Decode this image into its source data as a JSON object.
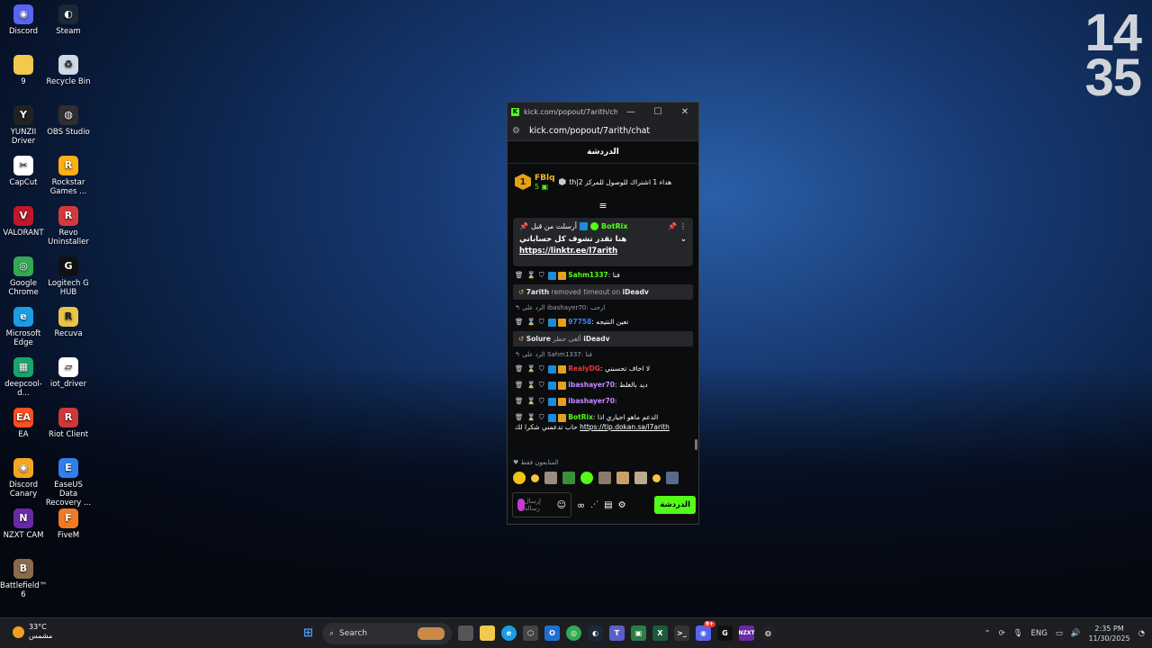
{
  "desktop": {
    "clock_hour": "14",
    "clock_minute": "35",
    "icons_col1": [
      {
        "label": "Discord",
        "icon": "discord-icon",
        "color": "#5865f2",
        "glyph": "◉"
      },
      {
        "label": "9",
        "icon": "folder-icon",
        "color": "#f2c94c",
        "glyph": ""
      },
      {
        "label": "YUNZII Driver",
        "icon": "yunzii-icon",
        "color": "#222222",
        "glyph": "Y"
      },
      {
        "label": "CapCut",
        "icon": "capcut-icon",
        "color": "#ffffff",
        "glyph": "✂"
      },
      {
        "label": "VALORANT",
        "icon": "valorant-icon",
        "color": "#c0172b",
        "glyph": "V"
      },
      {
        "label": "Google Chrome",
        "icon": "chrome-icon",
        "color": "#34a853",
        "glyph": "◎"
      },
      {
        "label": "Microsoft Edge",
        "icon": "edge-icon",
        "color": "#1b9de2",
        "glyph": "e"
      },
      {
        "label": "deepcool-d...",
        "icon": "deepcool-icon",
        "color": "#1aa56b",
        "glyph": "▦"
      },
      {
        "label": "EA",
        "icon": "ea-icon",
        "color": "#ff4f1e",
        "glyph": "EA"
      },
      {
        "label": "Discord Canary",
        "icon": "discord-canary-icon",
        "color": "#f5a623",
        "glyph": "◉"
      },
      {
        "label": "NZXT CAM",
        "icon": "nzxt-icon",
        "color": "#6a2aa8",
        "glyph": "N"
      },
      {
        "label": "Battlefield™ 6",
        "icon": "battlefield-icon",
        "color": "#8b6a4a",
        "glyph": "B"
      }
    ],
    "icons_col2": [
      {
        "label": "Steam",
        "icon": "steam-icon",
        "color": "#1b2838",
        "glyph": "◐"
      },
      {
        "label": "Recycle Bin",
        "icon": "recycle-bin-icon",
        "color": "#cfd8e3",
        "glyph": "♻"
      },
      {
        "label": "OBS Studio",
        "icon": "obs-icon",
        "color": "#302e31",
        "glyph": "◍"
      },
      {
        "label": "Rockstar Games ...",
        "icon": "rockstar-icon",
        "color": "#fcaf17",
        "glyph": "R"
      },
      {
        "label": "Revo Uninstaller",
        "icon": "revo-icon",
        "color": "#d33b3b",
        "glyph": "R"
      },
      {
        "label": "Logitech G HUB",
        "icon": "logitech-icon",
        "color": "#111111",
        "glyph": "G"
      },
      {
        "label": "Recuva",
        "icon": "recuva-icon",
        "color": "#e8c547",
        "glyph": "R"
      },
      {
        "label": "iot_driver",
        "icon": "iot-driver-icon",
        "color": "#ffffff",
        "glyph": "▱"
      },
      {
        "label": "Riot Client",
        "icon": "riot-icon",
        "color": "#d13639",
        "glyph": "R"
      },
      {
        "label": "EaseUS Data Recovery ...",
        "icon": "easeus-icon",
        "color": "#2f80ed",
        "glyph": "E"
      },
      {
        "label": "FiveM",
        "icon": "fivem-icon",
        "color": "#f37a23",
        "glyph": "F"
      }
    ]
  },
  "window": {
    "tab_title": "kick.com/popout/7arith/cha...",
    "url": "kick.com/popout/7arith/chat",
    "minimize": "—",
    "maximize": "☐",
    "close": "✕"
  },
  "chat": {
    "header": "الدردشة",
    "top_gifter": {
      "rank": "1",
      "name": "FBlq",
      "count": "5",
      "text": "th|هداء 1 اشتراك للوصول للمركز 2"
    },
    "pinned": {
      "author": "BotRix",
      "pinned_by": "أرسلت من قبل",
      "line1": "هنا تقدر تشوف كل حساباتي",
      "link": "https://linktr.ee/l7arith"
    },
    "messages": [
      {
        "kind": "msg",
        "user": "Sahm1337",
        "user_color": "#53fc18",
        "text": "فنا"
      },
      {
        "kind": "sys",
        "actor": "7arith",
        "action": "removed timeout on",
        "target": "iDeadv"
      },
      {
        "kind": "reply",
        "text": "الرد على ibashayer70: ارحب"
      },
      {
        "kind": "msg",
        "user": "97758",
        "user_color": "#3b82f6",
        "text": "تعين النتيجه"
      },
      {
        "kind": "sys",
        "actor": "Solure",
        "action": "ألغى حظر",
        "target": "iDeadv"
      },
      {
        "kind": "reply",
        "text": "الرد على Sahm1337: فنا"
      },
      {
        "kind": "msg",
        "user": "RealyDG",
        "user_color": "#e5383b",
        "text": "لا اخاف تحسنني"
      },
      {
        "kind": "msg",
        "user": "ibashayer70",
        "user_color": "#c58bff",
        "text": "ديد بالغلط"
      },
      {
        "kind": "msg",
        "user": "ibashayer70",
        "user_color": "#c58bff",
        "text": ""
      },
      {
        "kind": "msg",
        "user": "BotRix",
        "user_color": "#53fc18",
        "text": "الدعم ماهو اجباري اذا",
        "text2": "حاب تدعمني شكرا لك",
        "link": "https://tip.dokan.sa/l7arith"
      }
    ],
    "followers_label": "المتابعون فقط",
    "input_placeholder": "إرسال رسالة",
    "send_button": "الدردشة"
  },
  "taskbar": {
    "temperature": "33°C",
    "weather": "مشمس",
    "search_placeholder": "Search",
    "language": "ENG",
    "time": "2:35 PM",
    "date": "11/30/2025",
    "discord_badge": "9+"
  },
  "colors": {
    "kick_green": "#53fc18",
    "gold": "#f2b531"
  }
}
